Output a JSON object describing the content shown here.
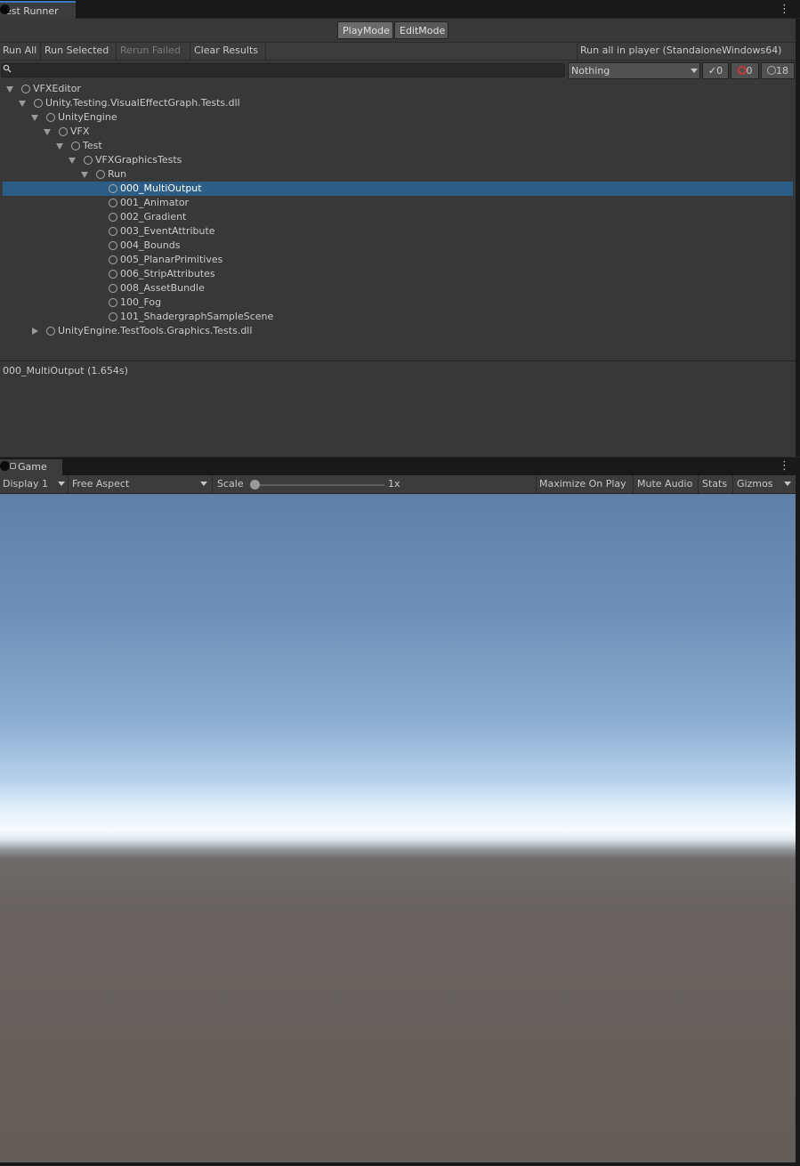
{
  "test_runner": {
    "tab_title": "est Runner",
    "modes": {
      "playmode": "PlayMode",
      "editmode": "EditMode"
    },
    "toolbar": {
      "run_all": "Run All",
      "run_selected": "Run Selected",
      "rerun_failed": "Rerun Failed",
      "clear_results": "Clear Results",
      "run_in_player": "Run all in player (StandaloneWindows64)"
    },
    "search": {
      "placeholder": ""
    },
    "filter": {
      "selected": "Nothing"
    },
    "counts": {
      "passed": "0",
      "failed": "0",
      "not_run": "18"
    },
    "tree": [
      {
        "label": "VFXEditor",
        "depth": 0,
        "expander": "down",
        "selected": false
      },
      {
        "label": "Unity.Testing.VisualEffectGraph.Tests.dll",
        "depth": 1,
        "expander": "down",
        "selected": false
      },
      {
        "label": "UnityEngine",
        "depth": 2,
        "expander": "down",
        "selected": false
      },
      {
        "label": "VFX",
        "depth": 3,
        "expander": "down",
        "selected": false
      },
      {
        "label": "Test",
        "depth": 4,
        "expander": "down",
        "selected": false
      },
      {
        "label": "VFXGraphicsTests",
        "depth": 5,
        "expander": "down",
        "selected": false
      },
      {
        "label": "Run",
        "depth": 6,
        "expander": "down",
        "selected": false
      },
      {
        "label": "000_MultiOutput",
        "depth": 7,
        "expander": "none",
        "selected": true
      },
      {
        "label": "001_Animator",
        "depth": 7,
        "expander": "none",
        "selected": false
      },
      {
        "label": "002_Gradient",
        "depth": 7,
        "expander": "none",
        "selected": false
      },
      {
        "label": "003_EventAttribute",
        "depth": 7,
        "expander": "none",
        "selected": false
      },
      {
        "label": "004_Bounds",
        "depth": 7,
        "expander": "none",
        "selected": false
      },
      {
        "label": "005_PlanarPrimitives",
        "depth": 7,
        "expander": "none",
        "selected": false
      },
      {
        "label": "006_StripAttributes",
        "depth": 7,
        "expander": "none",
        "selected": false
      },
      {
        "label": "008_AssetBundle",
        "depth": 7,
        "expander": "none",
        "selected": false
      },
      {
        "label": "100_Fog",
        "depth": 7,
        "expander": "none",
        "selected": false
      },
      {
        "label": "101_ShadergraphSampleScene",
        "depth": 7,
        "expander": "none",
        "selected": false
      },
      {
        "label": "UnityEngine.TestTools.Graphics.Tests.dll",
        "depth": 1,
        "expander": "right",
        "selected": false
      }
    ],
    "result": "000_MultiOutput (1.654s)"
  },
  "game": {
    "tab_title": "Game",
    "display": "Display 1",
    "aspect": "Free Aspect",
    "scale_label": "Scale",
    "scale_value": "1x",
    "maximize_on_play": "Maximize On Play",
    "mute_audio": "Mute Audio",
    "stats": "Stats",
    "gizmos": "Gizmos"
  },
  "colors": {
    "selection": "#2c5d87",
    "active_tab_accent": "#3a79bb",
    "panel_bg": "#383838",
    "toolbar_bg": "#3c3c3c",
    "failed_icon": "#c83a3a"
  },
  "icons": {
    "search": "search-icon",
    "passed": "check-icon",
    "failed": "failed-circle-icon",
    "not_run": "circle-icon",
    "menu": "kebab-menu-icon"
  }
}
